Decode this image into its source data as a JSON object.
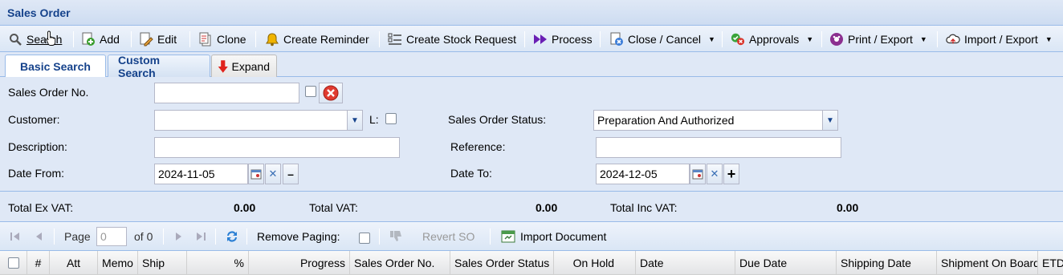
{
  "window": {
    "title": "Sales Order"
  },
  "toolbar": {
    "search": "Search",
    "add": "Add",
    "edit": "Edit",
    "clone": "Clone",
    "create_reminder": "Create Reminder",
    "create_stock_request": "Create Stock Request",
    "process": "Process",
    "close_cancel": "Close / Cancel",
    "approvals": "Approvals",
    "print_export": "Print / Export",
    "import_export": "Import / Export"
  },
  "tabs": {
    "basic": "Basic Search",
    "custom": "Custom Search",
    "expand": "Expand"
  },
  "form": {
    "so_no_label": "Sales Order No.",
    "so_no_value": "",
    "customer_label": "Customer:",
    "customer_value": "",
    "l_label": "L:",
    "status_label": "Sales Order Status:",
    "status_value": "Preparation And Authorized",
    "description_label": "Description:",
    "description_value": "",
    "reference_label": "Reference:",
    "reference_value": "",
    "date_from_label": "Date From:",
    "date_from_value": "2024-11-05",
    "date_to_label": "Date To:",
    "date_to_value": "2024-12-05"
  },
  "totals": {
    "ex_vat_label": "Total Ex VAT:",
    "ex_vat_value": "0.00",
    "vat_label": "Total VAT:",
    "vat_value": "0.00",
    "inc_vat_label": "Total Inc VAT:",
    "inc_vat_value": "0.00"
  },
  "paging": {
    "page_label": "Page",
    "page_value": "0",
    "of_label": "of 0",
    "remove_paging": "Remove Paging:",
    "revert_so": "Revert SO",
    "import_document": "Import Document"
  },
  "columns": [
    "#",
    "Att",
    "Memo",
    "Ship",
    "%",
    "Progress",
    "Sales Order No.",
    "Sales Order Status",
    "On Hold",
    "Date",
    "Due Date",
    "Shipping Date",
    "Shipment On Board",
    "ETD"
  ],
  "colors": {
    "header_blue": "#15428b",
    "panel": "#dfe8f6",
    "border": "#99bbe8"
  }
}
